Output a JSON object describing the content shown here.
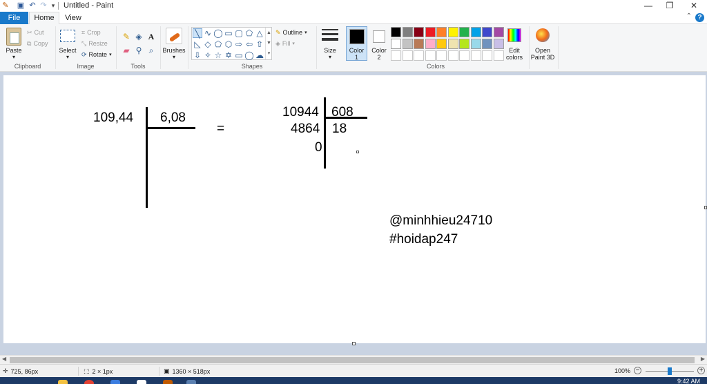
{
  "titlebar": {
    "title": "Untitled - Paint",
    "quick_access": [
      "save-icon",
      "undo-icon",
      "redo-icon",
      "customize-icon"
    ],
    "controls": [
      "minimize",
      "restore",
      "close"
    ]
  },
  "tabs": {
    "file": "File",
    "home": "Home",
    "view": "View"
  },
  "ribbon": {
    "clipboard": {
      "label": "Clipboard",
      "paste": "Paste",
      "cut": "Cut",
      "copy": "Copy"
    },
    "image": {
      "label": "Image",
      "select": "Select",
      "crop": "Crop",
      "resize": "Resize",
      "rotate": "Rotate"
    },
    "tools": {
      "label": "Tools"
    },
    "brushes": {
      "label": "Brushes"
    },
    "shapes": {
      "label": "Shapes",
      "outline": "Outline",
      "fill": "Fill"
    },
    "size": {
      "label": "Size"
    },
    "color1": {
      "label_line1": "Color",
      "label_line2": "1",
      "color": "#000000"
    },
    "color2": {
      "label_line1": "Color",
      "label_line2": "2",
      "color": "#ffffff"
    },
    "colors": {
      "label": "Colors",
      "row1": [
        "#000000",
        "#7f7f7f",
        "#880015",
        "#ed1c24",
        "#ff7f27",
        "#fff200",
        "#22b14c",
        "#00a2e8",
        "#3f48cc",
        "#a349a4"
      ],
      "row2": [
        "#ffffff",
        "#c3c3c3",
        "#b97a57",
        "#ffaec9",
        "#ffc90e",
        "#efe4b0",
        "#b5e61d",
        "#99d9ea",
        "#7092be",
        "#c8bfe7"
      ]
    },
    "edit_colors": {
      "line1": "Edit",
      "line2": "colors"
    },
    "paint3d": {
      "line1": "Open",
      "line2": "Paint 3D"
    }
  },
  "canvas": {
    "dividend": "109,44",
    "divisor": "6,08",
    "equals": "=",
    "int_dividend": "10944",
    "int_divisor": "608",
    "remainder_step": "4864",
    "quotient": "18",
    "final_remainder": "0",
    "watermark_user": "@minhhieu24710",
    "watermark_tag": "#hoidap247"
  },
  "statusbar": {
    "cursor_pos": "725, 86px",
    "selection_size": "2 × 1px",
    "canvas_size": "1360 × 518px",
    "zoom": "100%",
    "zoom_slider_fraction": 0.5
  },
  "taskbar": {
    "clock": "9:42 AM"
  }
}
